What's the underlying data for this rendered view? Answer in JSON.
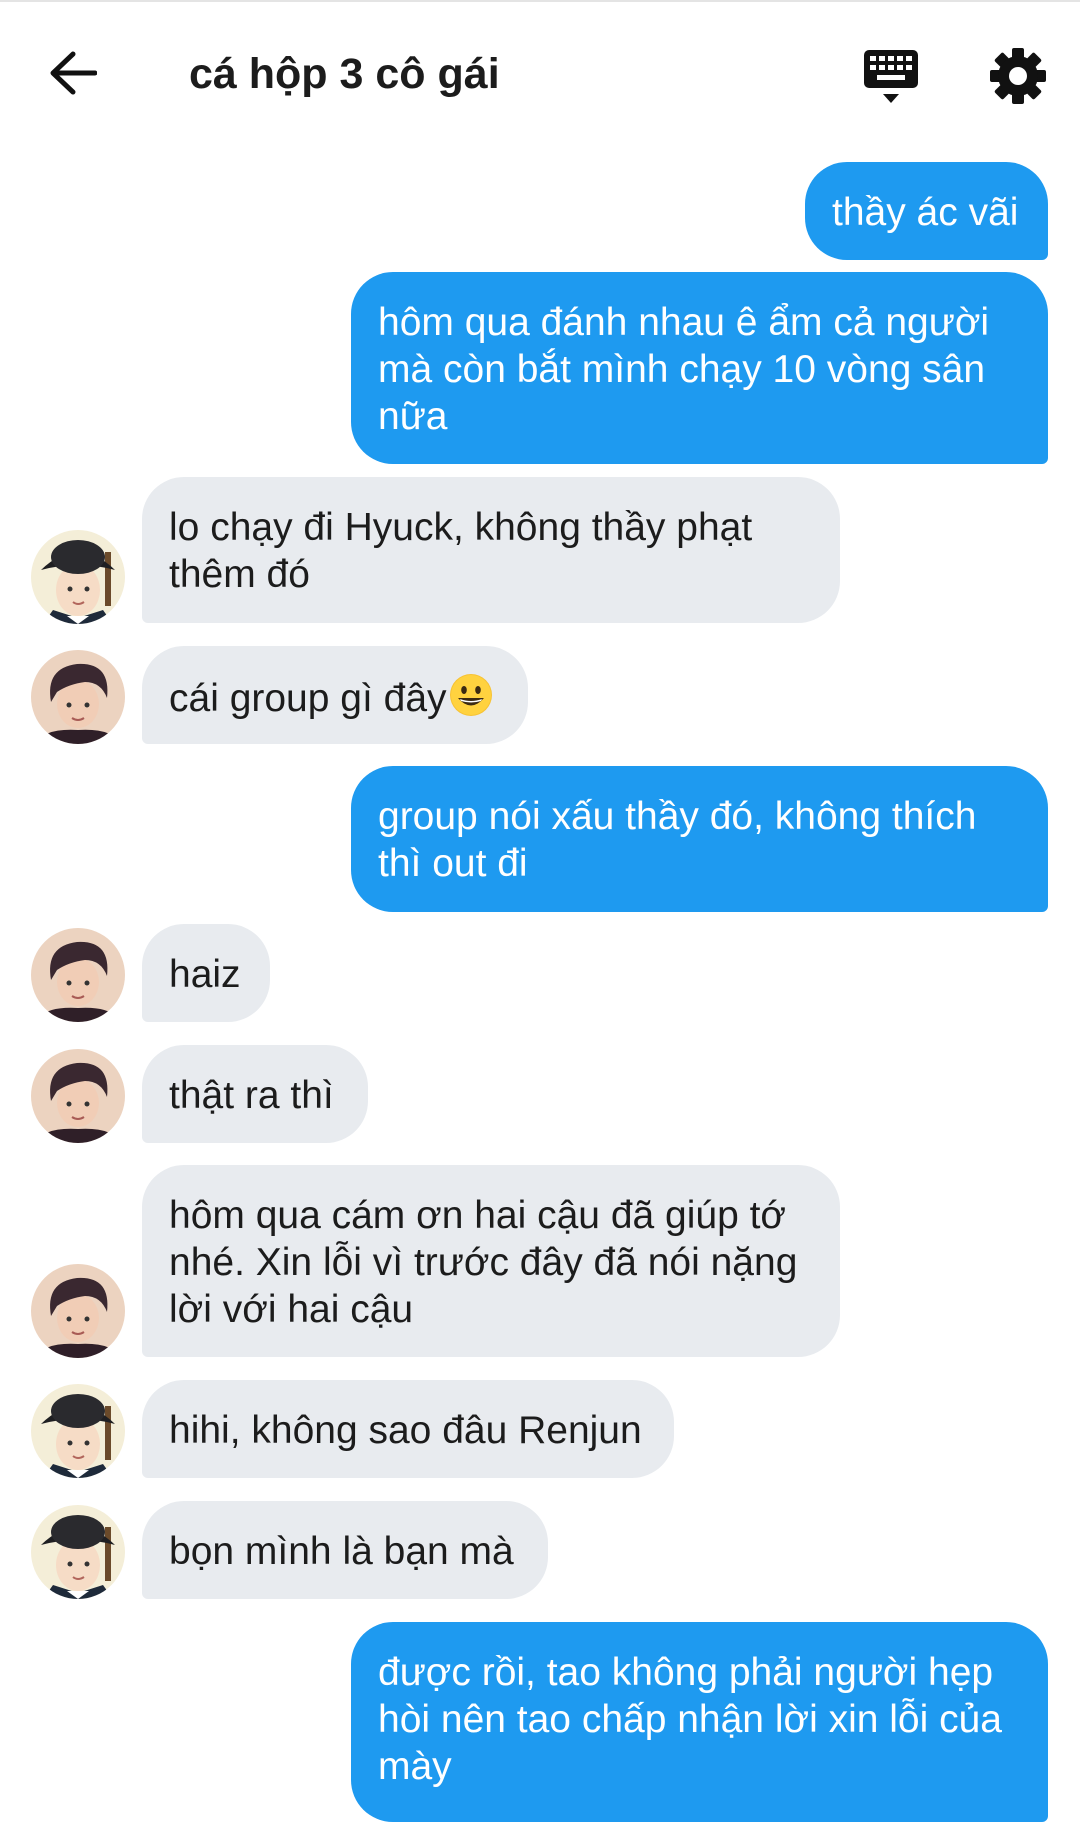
{
  "header": {
    "title": "cá hộp 3 cô gái",
    "back_icon": "arrow-left-icon",
    "keyboard_icon": "keyboard-icon",
    "settings_icon": "gear-icon"
  },
  "colors": {
    "outgoing_bubble": "#1e9af0",
    "incoming_bubble": "#e8ebef",
    "text": "#1c1c1c"
  },
  "messages": [
    {
      "dir": "out",
      "text": "thầy ác vãi"
    },
    {
      "dir": "out",
      "text": "hôm qua đánh nhau ê ẩm cả người mà còn bắt mình chạy 10 vòng sân nữa"
    },
    {
      "dir": "in",
      "sender": "hat-boy",
      "text": "lo chạy đi Hyuck, không thầy phạt thêm đó"
    },
    {
      "dir": "in",
      "sender": "dark-hair-boy",
      "text": "cái group gì đây",
      "emoji": "grinning-face-icon"
    },
    {
      "dir": "out",
      "text": "group nói xấu thầy đó, không thích thì out đi"
    },
    {
      "dir": "in",
      "sender": "dark-hair-boy",
      "text": "haiz"
    },
    {
      "dir": "in",
      "sender": "dark-hair-boy",
      "text": "thật ra thì"
    },
    {
      "dir": "in",
      "sender": "dark-hair-boy",
      "text": "hôm qua cám ơn hai cậu đã giúp tớ nhé. Xin lỗi vì trước đây đã nói nặng lời với hai cậu"
    },
    {
      "dir": "in",
      "sender": "hat-boy",
      "text": "hihi, không sao đâu Renjun"
    },
    {
      "dir": "in",
      "sender": "hat-boy",
      "text": "bọn mình là bạn mà"
    },
    {
      "dir": "out",
      "text": "được rồi, tao không phải người hẹp hòi nên tao chấp nhận lời xin lỗi của mày"
    }
  ]
}
